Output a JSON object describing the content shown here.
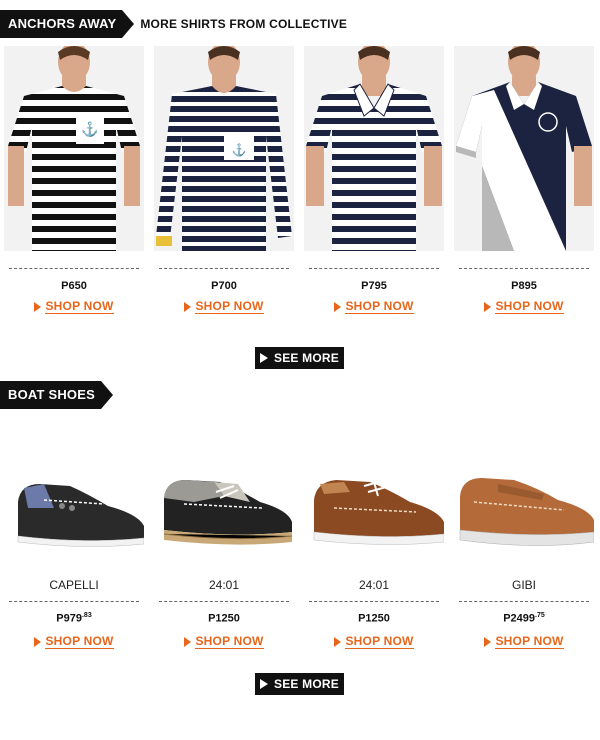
{
  "sections": {
    "shirts": {
      "tag": "ANCHORS AWAY",
      "subtitle": "MORE SHIRTS FROM COLLECTIVE",
      "see_more": "SEE MORE",
      "items": [
        {
          "price": "P650",
          "shop": "SHOP NOW",
          "image": "striped-tee-anchor-pocket"
        },
        {
          "price": "P700",
          "shop": "SHOP NOW",
          "image": "navy-striped-longsleeve"
        },
        {
          "price": "P795",
          "shop": "SHOP NOW",
          "image": "striped-polo"
        },
        {
          "price": "P895",
          "shop": "SHOP NOW",
          "image": "navy-diagonal-polo"
        }
      ]
    },
    "shoes": {
      "tag": "BOAT SHOES",
      "see_more": "SEE MORE",
      "items": [
        {
          "brand": "CAPELLI",
          "price": "P979",
          "price_cents": ".83",
          "shop": "SHOP NOW",
          "image": "black-boat-shoe"
        },
        {
          "brand": "24:01",
          "price": "P1250",
          "price_cents": "",
          "shop": "SHOP NOW",
          "image": "black-espadrille-boat-shoe"
        },
        {
          "brand": "24:01",
          "price": "P1250",
          "price_cents": "",
          "shop": "SHOP NOW",
          "image": "brown-boat-shoe"
        },
        {
          "brand": "GIBI",
          "price": "P2499",
          "price_cents": ".75",
          "shop": "SHOP NOW",
          "image": "tan-boat-shoe"
        }
      ]
    }
  },
  "colors": {
    "accent": "#e8661b",
    "dark": "#111111",
    "navy": "#1c2340"
  }
}
